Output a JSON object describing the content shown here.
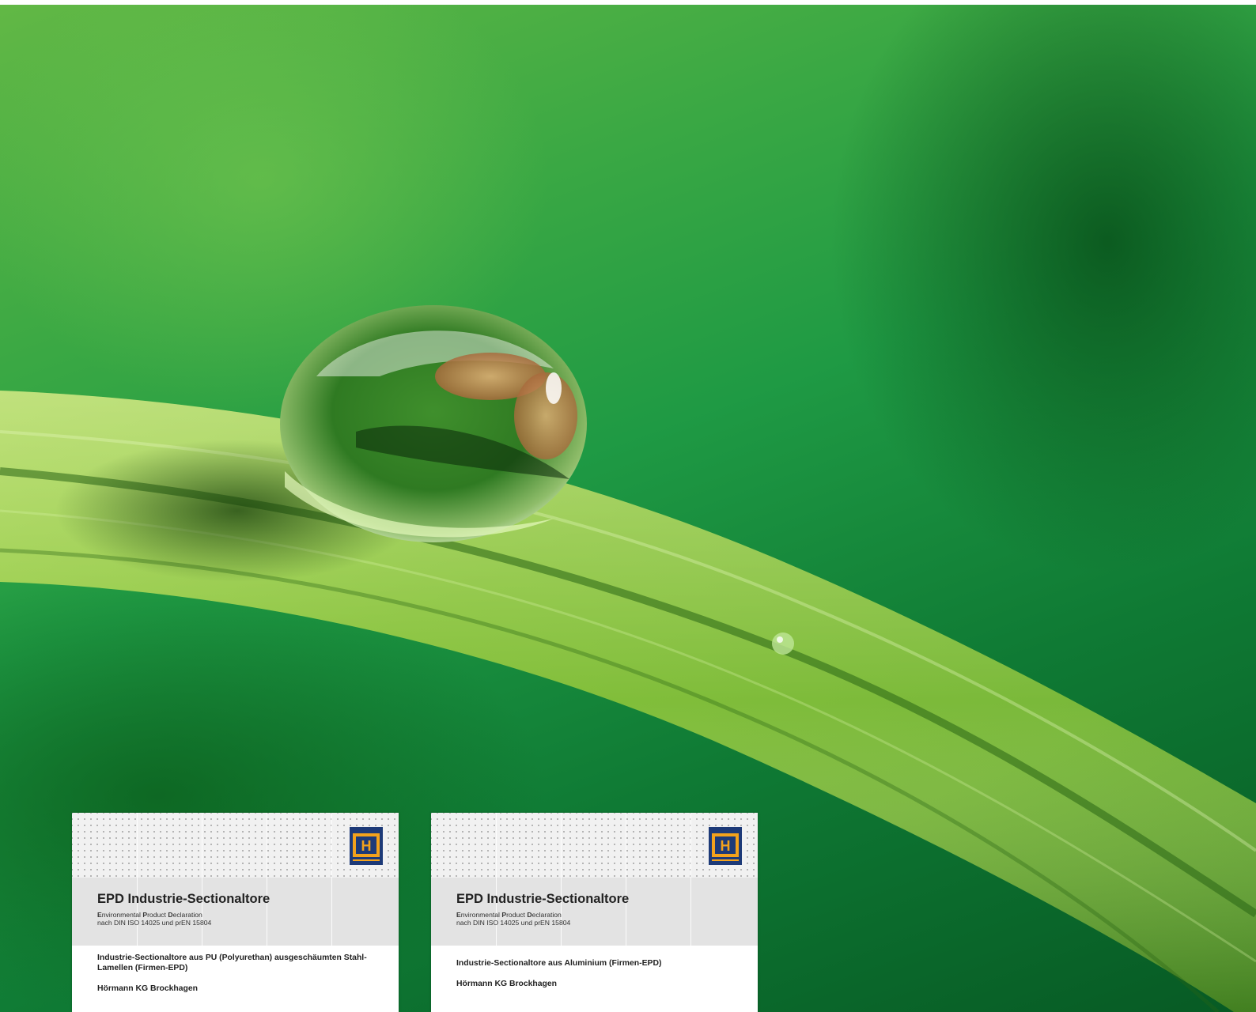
{
  "cards": [
    {
      "logo_icon": "hoermann-logo-icon",
      "title": "EPD Industrie-Sectionaltore",
      "subtitle": {
        "epd_line": [
          "E",
          "nvironmental ",
          "P",
          "roduct ",
          "D",
          "eclaration"
        ],
        "norm_line": "nach DIN ISO 14025 und prEN 15804"
      },
      "product": "Industrie-Sectionaltore aus PU (Polyurethan) ausgeschäumten Stahl-Lamellen (Firmen-EPD)",
      "company": "Hörmann KG Brockhagen"
    },
    {
      "logo_icon": "hoermann-logo-icon",
      "title": "EPD Industrie-Sectionaltore",
      "subtitle": {
        "epd_line": [
          "E",
          "nvironmental ",
          "P",
          "roduct ",
          "D",
          "eclaration"
        ],
        "norm_line": "nach DIN ISO 14025 und prEN 15804"
      },
      "product": "Industrie-Sectionaltore aus Aluminium (Firmen-EPD)",
      "company": "Hörmann KG Brockhagen"
    }
  ],
  "colors": {
    "logo_blue": "#1d3a78",
    "logo_orange": "#f3a21c",
    "leaf_green": "#8cc63f",
    "background_green": "#1f9a44"
  }
}
